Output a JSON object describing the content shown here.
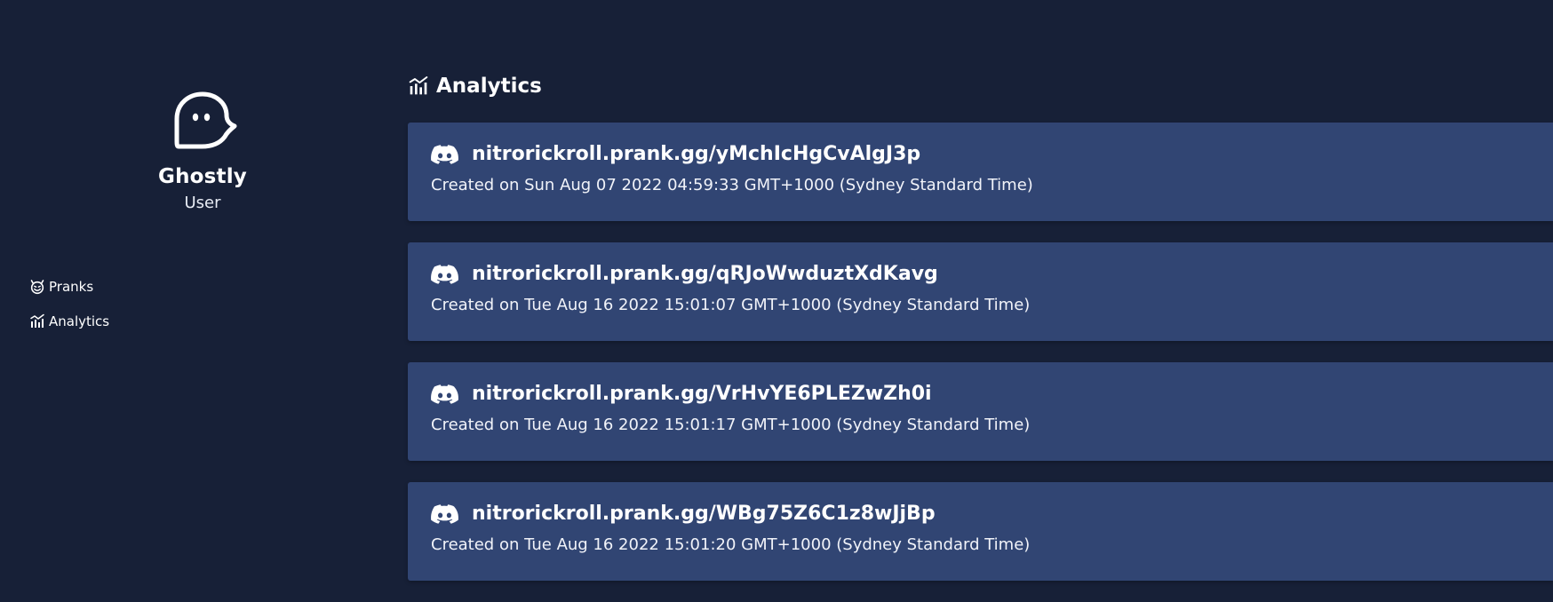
{
  "profile": {
    "name": "Ghostly",
    "role": "User",
    "avatar_icon": "ghost-icon"
  },
  "sidebar": {
    "items": [
      {
        "label": "Pranks",
        "icon": "devil-face-icon"
      },
      {
        "label": "Analytics",
        "icon": "bar-chart-icon"
      }
    ]
  },
  "main": {
    "title": "Analytics",
    "title_icon": "bar-chart-icon",
    "links": [
      {
        "url": "nitrorickroll.prank.gg/yMchIcHgCvAlgJ3p",
        "created": "Created on Sun Aug 07 2022 04:59:33 GMT+1000 (Sydney Standard Time)",
        "icon": "discord-icon"
      },
      {
        "url": "nitrorickroll.prank.gg/qRJoWwduztXdKavg",
        "created": "Created on Tue Aug 16 2022 15:01:07 GMT+1000 (Sydney Standard Time)",
        "icon": "discord-icon"
      },
      {
        "url": "nitrorickroll.prank.gg/VrHvYE6PLEZwZh0i",
        "created": "Created on Tue Aug 16 2022 15:01:17 GMT+1000 (Sydney Standard Time)",
        "icon": "discord-icon"
      },
      {
        "url": "nitrorickroll.prank.gg/WBg75Z6C1z8wJjBp",
        "created": "Created on Tue Aug 16 2022 15:01:20 GMT+1000 (Sydney Standard Time)",
        "icon": "discord-icon"
      }
    ]
  },
  "colors": {
    "background": "#172037",
    "card": "#314573",
    "text": "#ffffff"
  }
}
